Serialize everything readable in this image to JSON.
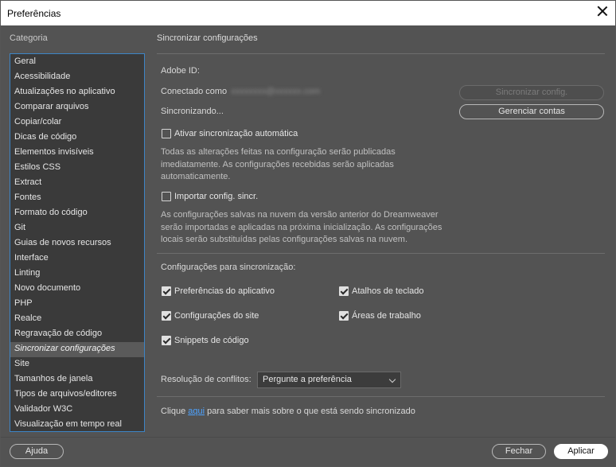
{
  "window": {
    "title": "Preferências"
  },
  "sidebar": {
    "heading": "Categoria",
    "items": [
      {
        "label": "Geral"
      },
      {
        "label": "Acessibilidade"
      },
      {
        "label": "Atualizações no aplicativo"
      },
      {
        "label": "Comparar arquivos"
      },
      {
        "label": "Copiar/colar"
      },
      {
        "label": "Dicas de código"
      },
      {
        "label": "Elementos invisíveis"
      },
      {
        "label": "Estilos CSS"
      },
      {
        "label": "Extract"
      },
      {
        "label": "Fontes"
      },
      {
        "label": "Formato do código"
      },
      {
        "label": "Git"
      },
      {
        "label": "Guias de novos recursos"
      },
      {
        "label": "Interface"
      },
      {
        "label": "Linting"
      },
      {
        "label": "Novo documento"
      },
      {
        "label": "PHP"
      },
      {
        "label": "Realce"
      },
      {
        "label": "Regravação de código"
      },
      {
        "label": "Sincronizar configurações"
      },
      {
        "label": "Site"
      },
      {
        "label": "Tamanhos de janela"
      },
      {
        "label": "Tipos de arquivos/editores"
      },
      {
        "label": "Validador W3C"
      },
      {
        "label": "Visualização em tempo real"
      }
    ],
    "selected_index": 19
  },
  "panel": {
    "title": "Sincronizar configurações",
    "adobe_id_label": "Adobe ID:",
    "connected_label": "Conectado como",
    "connected_value": "xxxxxxxx@xxxxxx.com",
    "syncing_label": "Sincronizando...",
    "sync_button": "Sincronizar config.",
    "manage_button": "Gerenciar contas",
    "auto_sync": {
      "label": "Ativar sincronização automática",
      "checked": false
    },
    "auto_sync_desc": "Todas as alterações feitas na configuração serão publicadas imediatamente. As configurações recebidas serão aplicadas automaticamente.",
    "import_sync": {
      "label": "Importar config. sincr.",
      "checked": false
    },
    "import_sync_desc": "As configurações salvas na nuvem da versão anterior do Dreamweaver serão importadas e aplicadas na próxima inicialização. As configurações locais serão substituídas pelas configurações salvas na nuvem.",
    "sync_section_label": "Configurações para sincronização:",
    "sync_options": {
      "app_prefs": {
        "label": "Preferências do aplicativo",
        "checked": true
      },
      "shortcuts": {
        "label": "Atalhos de teclado",
        "checked": true
      },
      "site_settings": {
        "label": "Configurações do site",
        "checked": true
      },
      "workspaces": {
        "label": "Áreas de trabalho",
        "checked": true
      },
      "snippets": {
        "label": "Snippets de código",
        "checked": true
      }
    },
    "conflict_label": "Resolução de conflitos:",
    "conflict_value": "Pergunte a preferência",
    "info_prefix": "Clique ",
    "info_link": "aqui",
    "info_suffix": " para saber mais sobre o que está sendo sincronizado"
  },
  "footer": {
    "help_button": "Ajuda",
    "close_button": "Fechar",
    "apply_button": "Aplicar"
  },
  "colors": {
    "background": "#535353",
    "list_background": "#3a3a3a",
    "list_border": "#3d85c6",
    "link": "#4ea3ff"
  }
}
